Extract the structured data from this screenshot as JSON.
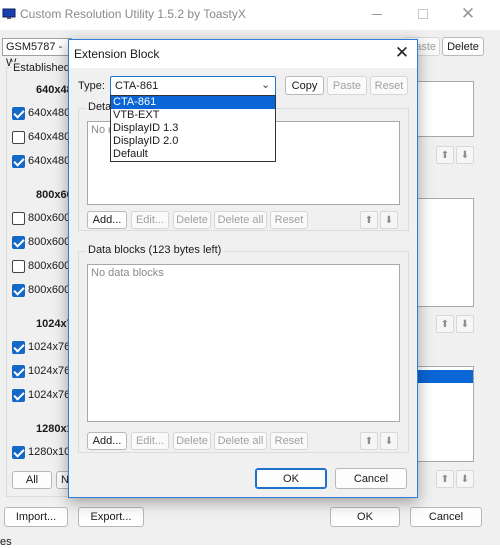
{
  "main_window": {
    "title": "Custom Resolution Utility 1.5.2 by ToastyX",
    "monitor_select": "GSM5787 - W",
    "paste_partial": "aste",
    "delete_label": "Delete",
    "established_label": "Established",
    "groups": [
      {
        "header": "640x48",
        "items": [
          {
            "label": "640x480",
            "checked": true
          },
          {
            "label": "640x480",
            "checked": false
          },
          {
            "label": "640x480",
            "checked": true
          }
        ]
      },
      {
        "header": "800x60",
        "items": [
          {
            "label": "800x600",
            "checked": false
          },
          {
            "label": "800x600",
            "checked": true
          },
          {
            "label": "800x600",
            "checked": false
          },
          {
            "label": "800x600",
            "checked": true
          }
        ]
      },
      {
        "header": "1024x7",
        "items": [
          {
            "label": "1024x76",
            "checked": true
          },
          {
            "label": "1024x76",
            "checked": true
          },
          {
            "label": "1024x76",
            "checked": true
          }
        ]
      },
      {
        "header": "1280x1",
        "items": [
          {
            "label": "1280x10",
            "checked": true
          }
        ]
      }
    ],
    "all_label": "All",
    "n_partial": "N",
    "import_label": "Import...",
    "export_label": "Export...",
    "ok_label": "OK",
    "cancel_label": "Cancel",
    "bottom_partial": "es"
  },
  "dialog": {
    "title": "Extension Block",
    "type_label": "Type:",
    "type_value": "CTA-861",
    "dropdown_options": [
      "CTA-861",
      "VTB-EXT",
      "DisplayID 1.3",
      "DisplayID 2.0",
      "Default"
    ],
    "selected_option": "CTA-861",
    "copy_label": "Copy",
    "paste_label": "Paste",
    "reset_label": "Reset",
    "detailed_partial": "Deta",
    "detailed_empty_partial": "No d",
    "data_blocks_label": "Data blocks (123 bytes left)",
    "no_data_blocks": "No data blocks",
    "add_label": "Add...",
    "edit_label": "Edit...",
    "delete_label": "Delete",
    "delete_all_label": "Delete all",
    "reset_btn_label": "Reset",
    "ok_label": "OK",
    "cancel_label": "Cancel"
  },
  "colors": {
    "accent": "#1468c6",
    "selection": "#0a66d6",
    "dialog_border": "#2f7fd8"
  }
}
